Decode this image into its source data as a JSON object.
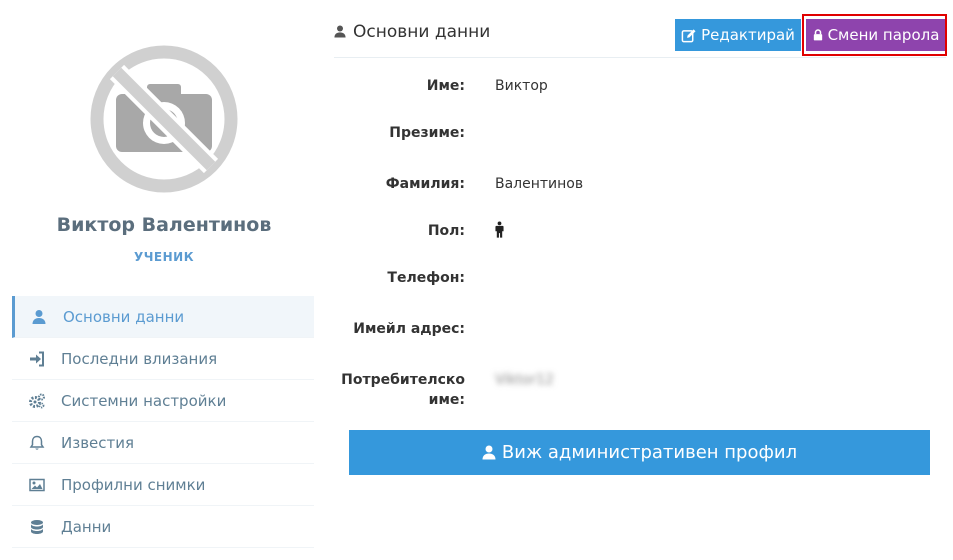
{
  "profile": {
    "name": "Виктор Валентинов",
    "role": "УЧЕНИК",
    "avatar_icon": "no-photo-camera-icon"
  },
  "sidebar": {
    "items": [
      {
        "label": "Основни данни",
        "icon": "user-icon",
        "active": true
      },
      {
        "label": "Последни влизания",
        "icon": "sign-in-icon"
      },
      {
        "label": "Системни настройки",
        "icon": "gears-icon"
      },
      {
        "label": "Известия",
        "icon": "bell-icon"
      },
      {
        "label": "Профилни снимки",
        "icon": "image-icon"
      },
      {
        "label": "Данни",
        "icon": "database-icon"
      }
    ]
  },
  "panel": {
    "title": "Основни данни",
    "edit_label": "Редактирай",
    "change_password_label": "Смени парола"
  },
  "fields": {
    "first_name": {
      "label": "Име:",
      "value": "Виктор"
    },
    "middle_name": {
      "label": "Презиме:",
      "value": ""
    },
    "last_name": {
      "label": "Фамилия:",
      "value": "Валентинов"
    },
    "gender": {
      "label": "Пол:",
      "value_icon": "male-icon"
    },
    "phone": {
      "label": "Телефон:",
      "value": ""
    },
    "email": {
      "label": "Имейл адрес:",
      "value": ""
    },
    "username": {
      "label_line1": "Потребителско",
      "label_line2": "име:",
      "value": "Viktor12"
    }
  },
  "admin_button": {
    "label": "Виж административен профил"
  },
  "colors": {
    "primary": "#3598dc",
    "purple": "#8e44ad",
    "highlight": "#e00000",
    "menu_text": "#5f7f94",
    "role": "#5b9bd1"
  }
}
